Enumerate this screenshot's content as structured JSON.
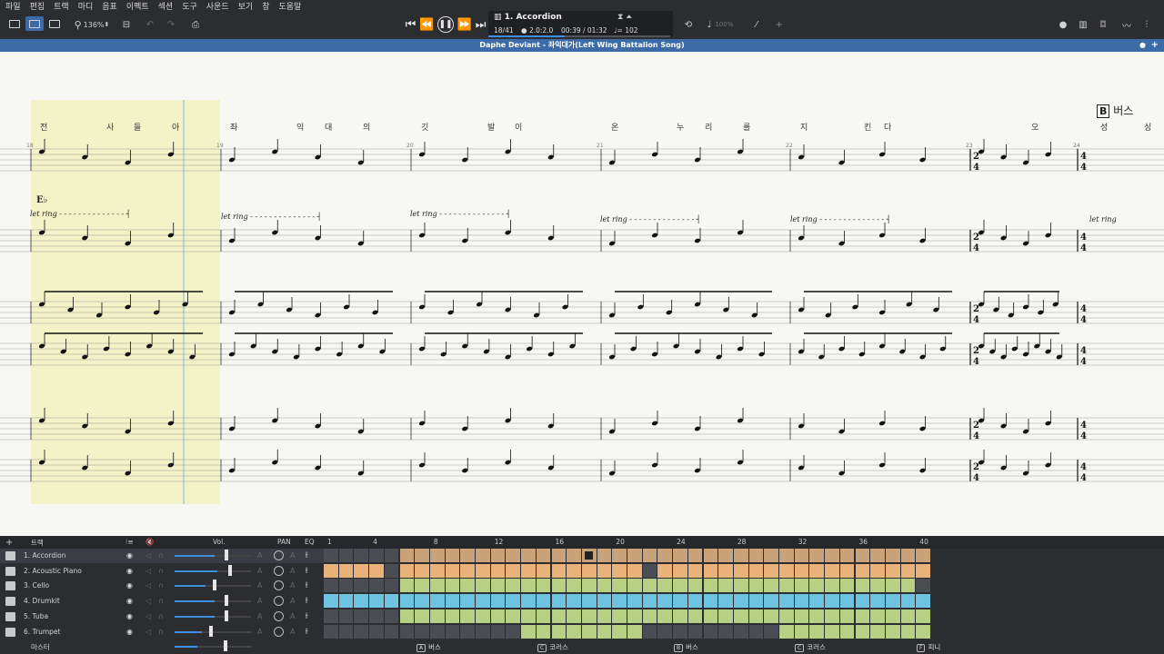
{
  "menu": [
    "파일",
    "편집",
    "트랙",
    "마디",
    "음표",
    "이펙트",
    "섹션",
    "도구",
    "사운드",
    "보기",
    "창",
    "도움말"
  ],
  "toolbar": {
    "zoom": "136%"
  },
  "lcd": {
    "track": "1. Accordion",
    "position": "18/41",
    "beat": "2.0:2.0",
    "time": "00:39 / 01:32",
    "tempo": "♩= 102",
    "progress": 0.42
  },
  "zoom_right": "100%",
  "title": "Daphe Deviant - 좌익대가(Left Wing Battalion Song)",
  "score": {
    "section_letter": "B",
    "section_name": "버스",
    "chord": "E♭",
    "let_ring": "let ring",
    "lyrics": [
      "전",
      "사",
      "들",
      "아",
      "좌",
      "익",
      "대",
      "의",
      "깃",
      "발",
      "이",
      "온",
      "누",
      "리",
      "를",
      "지",
      "킨",
      "다",
      "오",
      "성",
      "싱"
    ],
    "measure_numbers": [
      "18",
      "19",
      "20",
      "21",
      "22",
      "23",
      "24"
    ],
    "time_sig": [
      "2",
      "4",
      "4",
      "4"
    ]
  },
  "tracks_header": {
    "title": "트랙",
    "vol": "Vol.",
    "pan": "PAN",
    "eq": "EQ"
  },
  "tracks": [
    {
      "name": "1. Accordion",
      "vol": 0.65,
      "icon": "accordion-icon",
      "selected": true
    },
    {
      "name": "2. Acoustic Piano",
      "vol": 0.7,
      "icon": "piano-icon",
      "selected": false
    },
    {
      "name": "3. Cello",
      "vol": 0.5,
      "icon": "cello-icon",
      "selected": false
    },
    {
      "name": "4. Drumkit",
      "vol": 0.65,
      "icon": "drumkit-icon",
      "selected": false
    },
    {
      "name": "5. Tuba",
      "vol": 0.65,
      "icon": "tuba-icon",
      "selected": false
    },
    {
      "name": "6. Trumpet",
      "vol": 0.45,
      "icon": "trumpet-icon",
      "selected": false
    }
  ],
  "master": "마스터",
  "bar_numbers": [
    "1",
    "4",
    "8",
    "12",
    "16",
    "20",
    "24",
    "28",
    "32",
    "36",
    "40"
  ],
  "markers": [
    {
      "letter": "A",
      "name": "버스"
    },
    {
      "letter": "C",
      "name": "코러스"
    },
    {
      "letter": "B",
      "name": "버스"
    },
    {
      "letter": "C",
      "name": "코러스"
    },
    {
      "letter": "F",
      "name": "피니"
    }
  ],
  "colors": {
    "accordion": "#c9a27a",
    "piano": "#e8b27a",
    "cello": "#b8d084",
    "drumkit": "#6ec3e0",
    "tuba": "#b8d084",
    "trumpet": "#b8d084",
    "empty": "#4a4d53",
    "highlight": "#f4f3c8",
    "accent": "#3c6ba8"
  }
}
